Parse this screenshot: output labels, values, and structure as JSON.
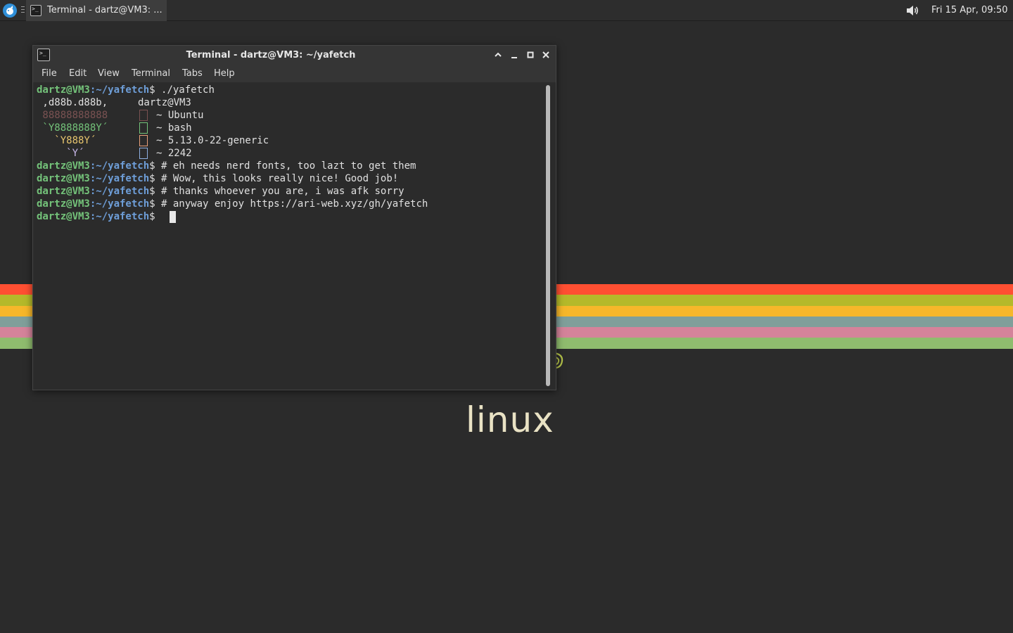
{
  "panel": {
    "task_title": "Terminal - dartz@VM3: ...",
    "clock": "Fri 15 Apr, 09:50",
    "launcher_icon": "whisker-menu-icon",
    "volume_icon": "volume-icon"
  },
  "wallpaper": {
    "stripe_colors": [
      "#ff4f32",
      "#b4b92a",
      "#f6b72a",
      "#7f9f9a",
      "#d4839a",
      "#8fbc6e"
    ],
    "logo_text": "linux"
  },
  "window": {
    "title": "Terminal - dartz@VM3: ~/yafetch",
    "menu": [
      "File",
      "Edit",
      "View",
      "Terminal",
      "Tabs",
      "Help"
    ]
  },
  "terminal": {
    "prompt_user": "dartz@VM3",
    "prompt_path": ":~/yafetch",
    "prompt_symbol": "$",
    "command": " ./yafetch",
    "art": [
      " ,d88b.d88b,",
      " 88888888888",
      " `Y8888888Y´",
      "   `Y888Y´",
      "     `Y´"
    ],
    "art_colors": [
      "#e0e0e0",
      "#7a5252",
      "#74c37a",
      "#e8c56e",
      "#c8b7e8"
    ],
    "header": "dartz@VM3",
    "info": [
      "~ Ubuntu",
      "~ bash",
      "~ 5.13.0-22-generic",
      "~ 2242"
    ],
    "comments": [
      " # eh needs nerd fonts, too lazt to get them",
      " # Wow, this looks really nice! Good job!",
      " # thanks whoever you are, i was afk sorry",
      " # anyway enjoy https://ari-web.xyz/gh/yafetch"
    ]
  }
}
